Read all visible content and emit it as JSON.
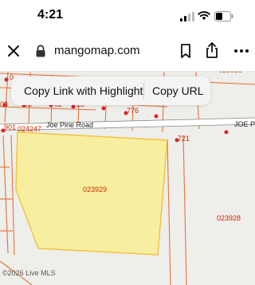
{
  "status_bar": {
    "time": "4:21"
  },
  "browser": {
    "url": "mangomap.com",
    "icons": {
      "close": "close-icon",
      "lock": "lock-icon",
      "bookmark": "bookmark-icon",
      "share": "share-icon",
      "more": "more-icon"
    }
  },
  "context_menu": {
    "copy_link_highlight": "Copy Link with Highlight",
    "copy_url": "Copy URL"
  },
  "map": {
    "highlight_color": "#f7eea0",
    "parcel_line_color": "#e8723a",
    "labels": {
      "p023928_top": "023928",
      "p023928_right": "023928",
      "p024247": "024247",
      "p023929": "023929",
      "p776": "776",
      "p721": "721",
      "p901": "901",
      "p_top_left": "0",
      "p_left": "08",
      "p_mid_a": "08",
      "p_mid_b": "02",
      "p_mid_c": "25"
    },
    "roads": {
      "joe_p": "JOE P",
      "upper_road": "Joe Pine Road"
    },
    "attribution": "©2026 Live MLS"
  }
}
